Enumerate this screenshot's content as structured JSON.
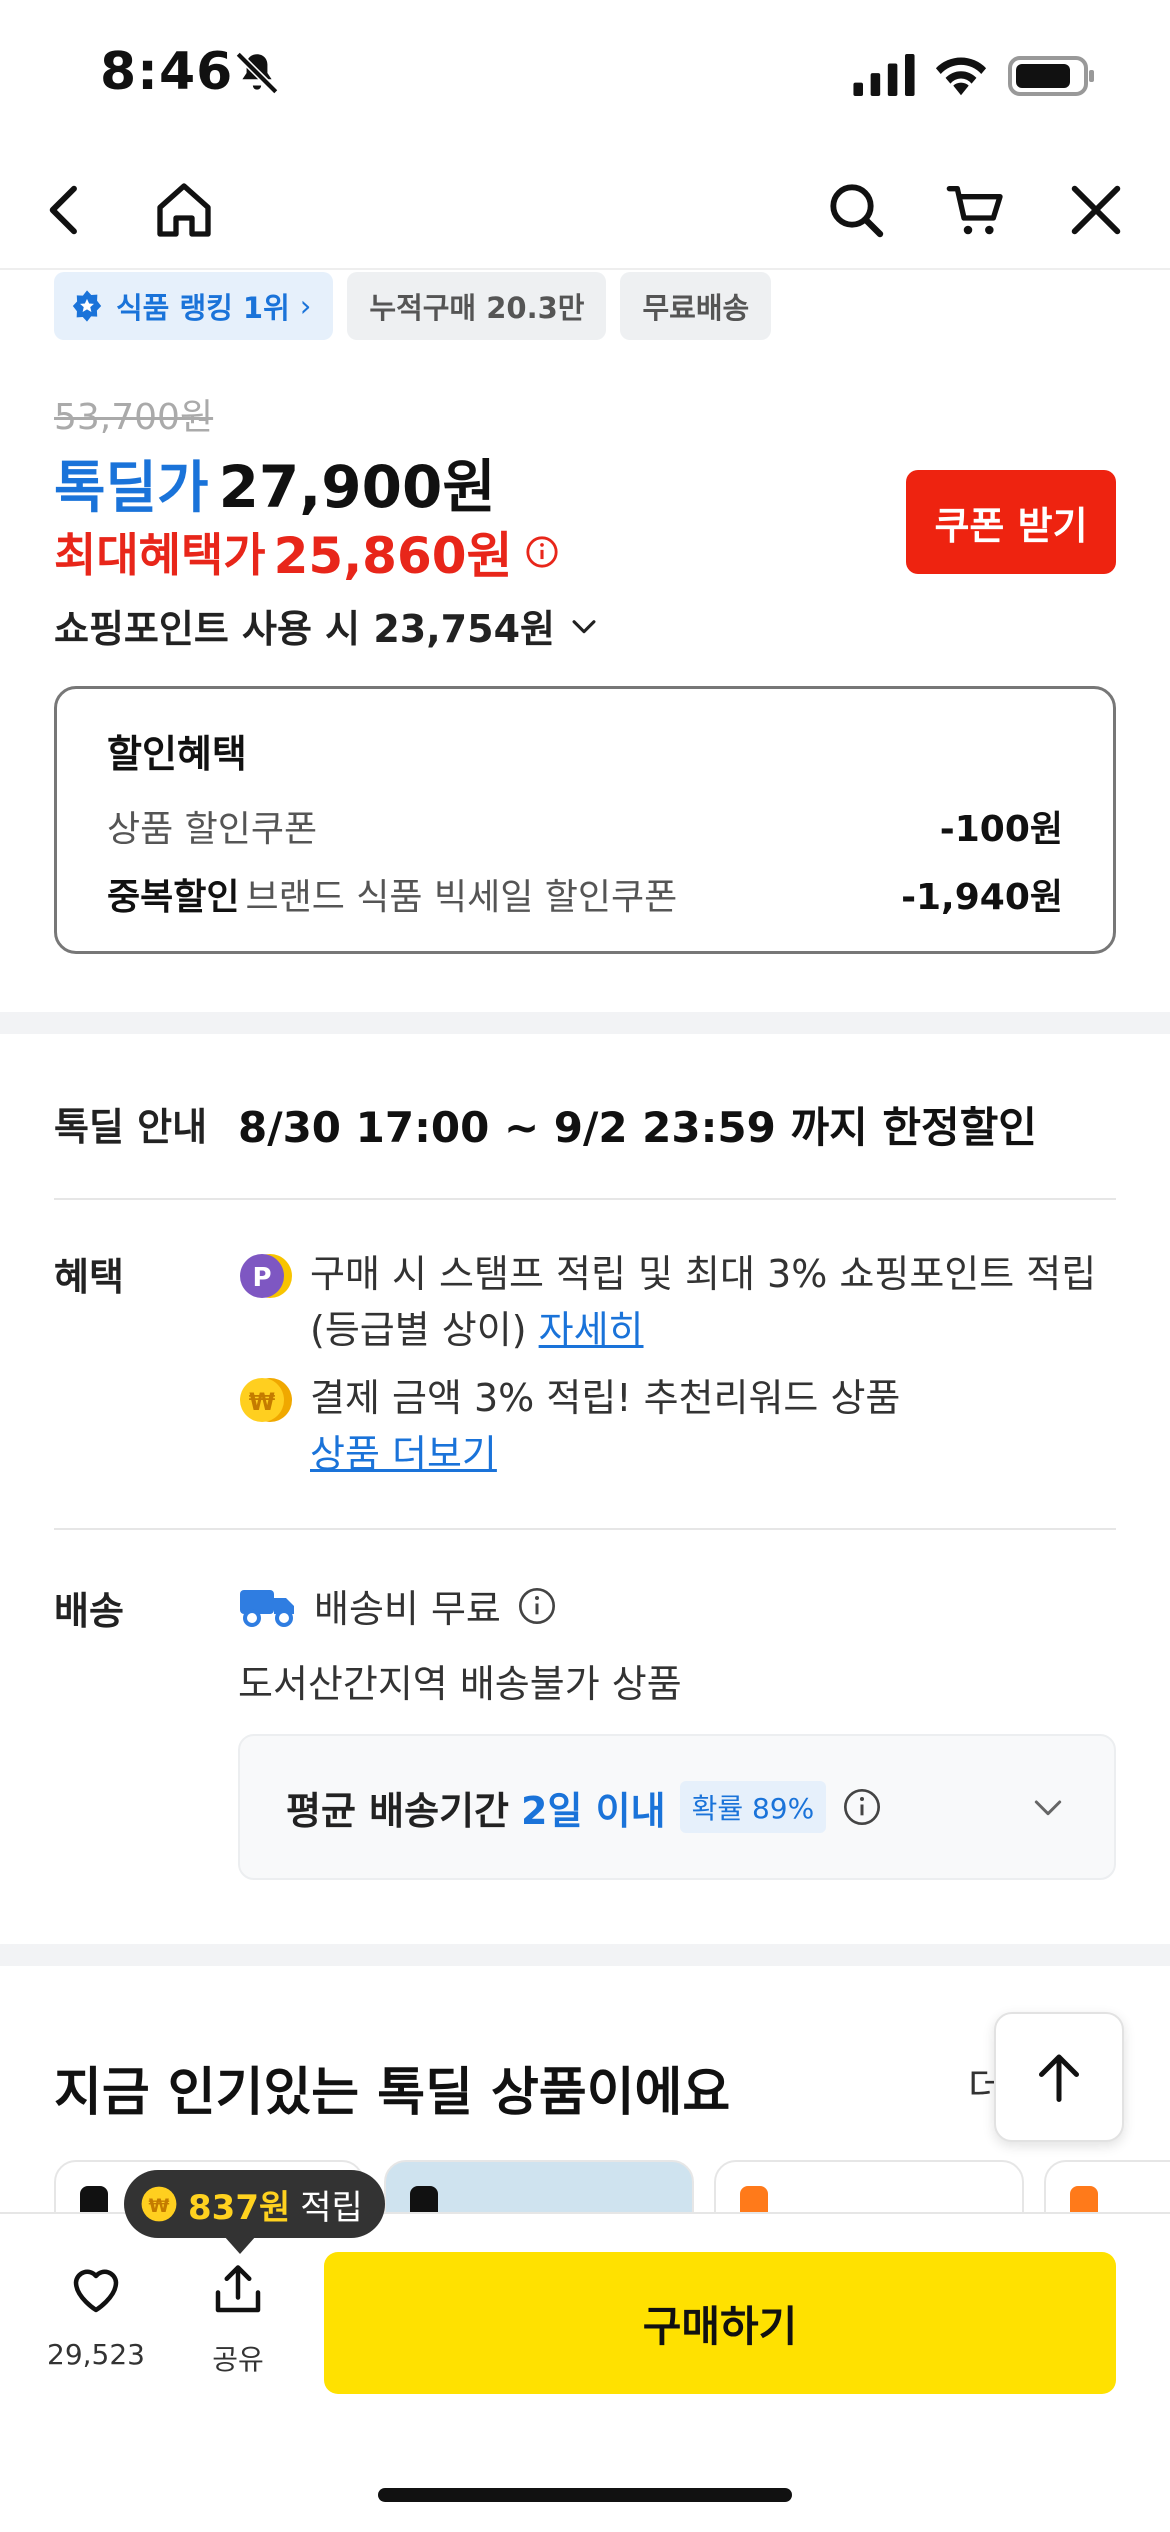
{
  "status": {
    "time": "8:46"
  },
  "badges": {
    "rank": "식품 랭킹 1위",
    "cumulative": "누적구매 20.3만",
    "shipping": "무료배송"
  },
  "price": {
    "original": "53,700원",
    "deal_label": "톡딜가",
    "deal_price": "27,900원",
    "max_label": "최대혜택가",
    "max_price": "25,860원",
    "coupon_button": "쿠폰 받기",
    "point_text": "쇼핑포인트 사용 시 23,754원"
  },
  "discount": {
    "title": "할인혜택",
    "rows": [
      {
        "prefix": "",
        "label": "상품 할인쿠폰",
        "amount": "-100원"
      },
      {
        "prefix": "중복할인",
        "label": "브랜드 식품 빅세일 할인쿠폰",
        "amount": "-1,940원"
      }
    ]
  },
  "deal_info": {
    "label": "톡딜 안내",
    "text": "8/30 17:00 ~ 9/2 23:59 까지 한정할인"
  },
  "benefit": {
    "label": "혜택",
    "line1_text": "구매 시 스탬프 적립 및 최대 3% 쇼핑포인트 적립 (등급별 상이)",
    "line1_link": "자세히",
    "line2_text": "결제 금액 3% 적립! 추천리워드 상품",
    "line2_link": "상품 더보기"
  },
  "delivery": {
    "label": "배송",
    "fee": "배송비 무료",
    "restriction": "도서산간지역 배송불가 상품",
    "avg_label": "평균 배송기간",
    "avg_value": "2일 이내",
    "probability": "확률 89%"
  },
  "popular": {
    "title": "지금 인기있는 톡딜 상품이에요",
    "more": "더"
  },
  "bottom": {
    "reward_amount": "837원",
    "reward_label": "적립",
    "like_count": "29,523",
    "share_label": "공유",
    "buy_button": "구매하기"
  },
  "colors": {
    "brand_blue": "#1a73d9",
    "sale_red": "#e8261a",
    "buy_yellow": "#ffe100"
  }
}
